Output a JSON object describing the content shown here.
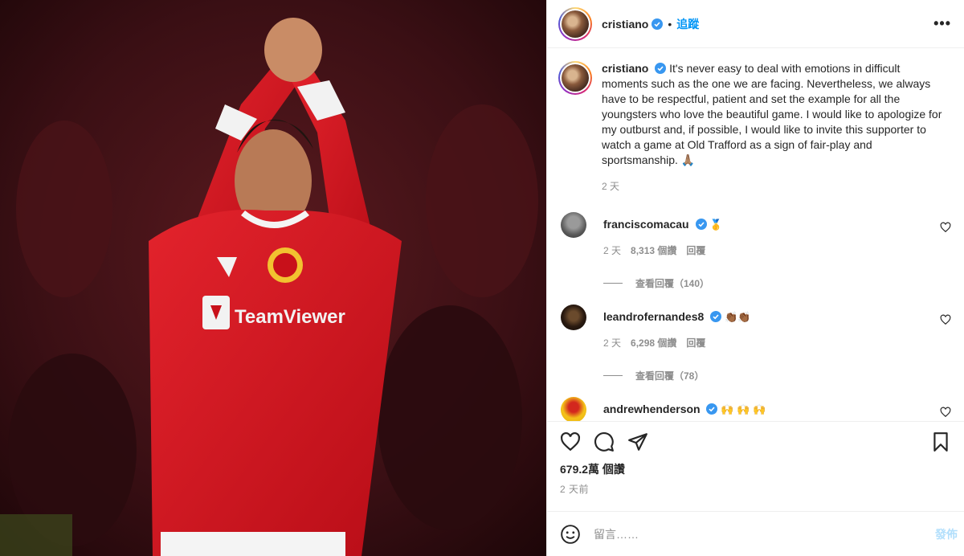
{
  "post": {
    "username": "cristiano",
    "follow_label": "追蹤",
    "more_label": "•••",
    "caption_username": "cristiano",
    "caption": "It's never easy to deal with emotions in difficult moments such as the one we are facing. Nevertheless, we always have to be respectful, patient and set the example for all the youngsters who love the beautiful game. I would like to apologize for my outburst and, if possible, I would like to invite this supporter to watch a game at Old Trafford as a sign of fair-play and sportsmanship. 🙏🏽",
    "caption_time": "2 天",
    "likes": "679.2萬 個讚",
    "time_ago": "2 天前",
    "comment_placeholder": "留言……",
    "post_label": "發佈"
  },
  "comments": [
    {
      "username": "franciscomacau",
      "text": "🥇",
      "time": "2 天",
      "likes": "8,313 個讚",
      "reply": "回覆",
      "view_replies": "查看回覆（140）"
    },
    {
      "username": "leandrofernandes8",
      "text": "👏🏾👏🏾",
      "time": "2 天",
      "likes": "6,298 個讚",
      "reply": "回覆",
      "view_replies": "查看回覆（78）"
    },
    {
      "username": "andrewhenderson",
      "text": "🙌 🙌 🙌"
    }
  ],
  "colors": {
    "accent": "#0095f6",
    "verified": "#3897f0",
    "muted": "#8e8e8e",
    "jersey_red": "#d4121e"
  },
  "icons": [
    "heart-icon",
    "comment-icon",
    "share-icon",
    "bookmark-icon",
    "emoji-icon",
    "verified-icon",
    "more-icon"
  ]
}
